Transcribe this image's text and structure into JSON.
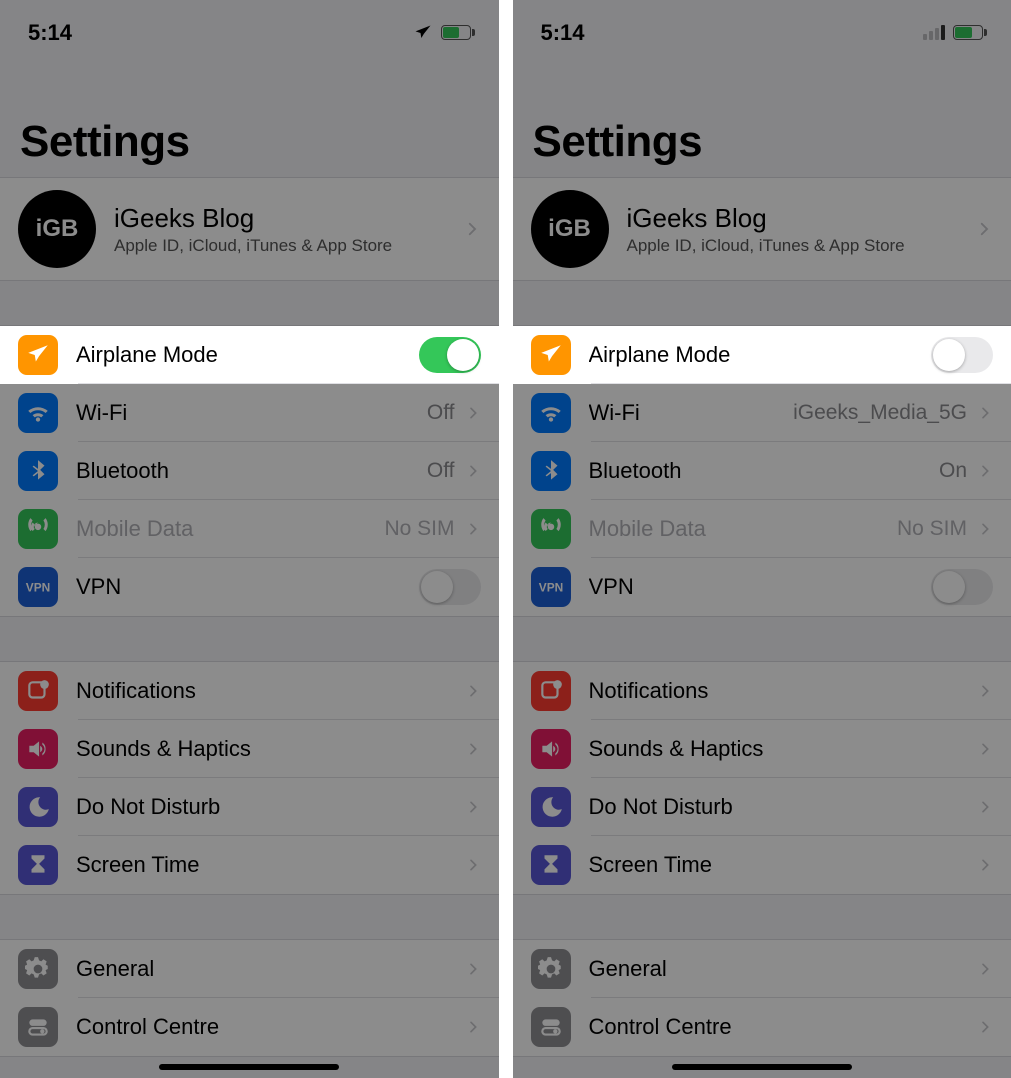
{
  "left": {
    "status": {
      "time": "5:14",
      "airplane_visible": true
    },
    "title": "Settings",
    "profile": {
      "avatar_text": "iGB",
      "name": "iGeeks Blog",
      "subtitle": "Apple ID, iCloud, iTunes & App Store"
    },
    "airplane": {
      "label": "Airplane Mode",
      "on": true
    },
    "wifi": {
      "label": "Wi-Fi",
      "value": "Off"
    },
    "bluetooth": {
      "label": "Bluetooth",
      "value": "Off"
    },
    "mobile": {
      "label": "Mobile Data",
      "value": "No SIM"
    },
    "vpn": {
      "label": "VPN",
      "on": false
    },
    "notifications": {
      "label": "Notifications"
    },
    "sounds": {
      "label": "Sounds & Haptics"
    },
    "dnd": {
      "label": "Do Not Disturb"
    },
    "screentime": {
      "label": "Screen Time"
    },
    "general": {
      "label": "General"
    },
    "control": {
      "label": "Control Centre"
    }
  },
  "right": {
    "status": {
      "time": "5:14",
      "airplane_visible": false
    },
    "title": "Settings",
    "profile": {
      "avatar_text": "iGB",
      "name": "iGeeks Blog",
      "subtitle": "Apple ID, iCloud, iTunes & App Store"
    },
    "airplane": {
      "label": "Airplane Mode",
      "on": false
    },
    "wifi": {
      "label": "Wi-Fi",
      "value": "iGeeks_Media_5G"
    },
    "bluetooth": {
      "label": "Bluetooth",
      "value": "On"
    },
    "mobile": {
      "label": "Mobile Data",
      "value": "No SIM"
    },
    "vpn": {
      "label": "VPN",
      "on": false
    },
    "notifications": {
      "label": "Notifications"
    },
    "sounds": {
      "label": "Sounds & Haptics"
    },
    "dnd": {
      "label": "Do Not Disturb"
    },
    "screentime": {
      "label": "Screen Time"
    },
    "general": {
      "label": "General"
    },
    "control": {
      "label": "Control Centre"
    }
  }
}
